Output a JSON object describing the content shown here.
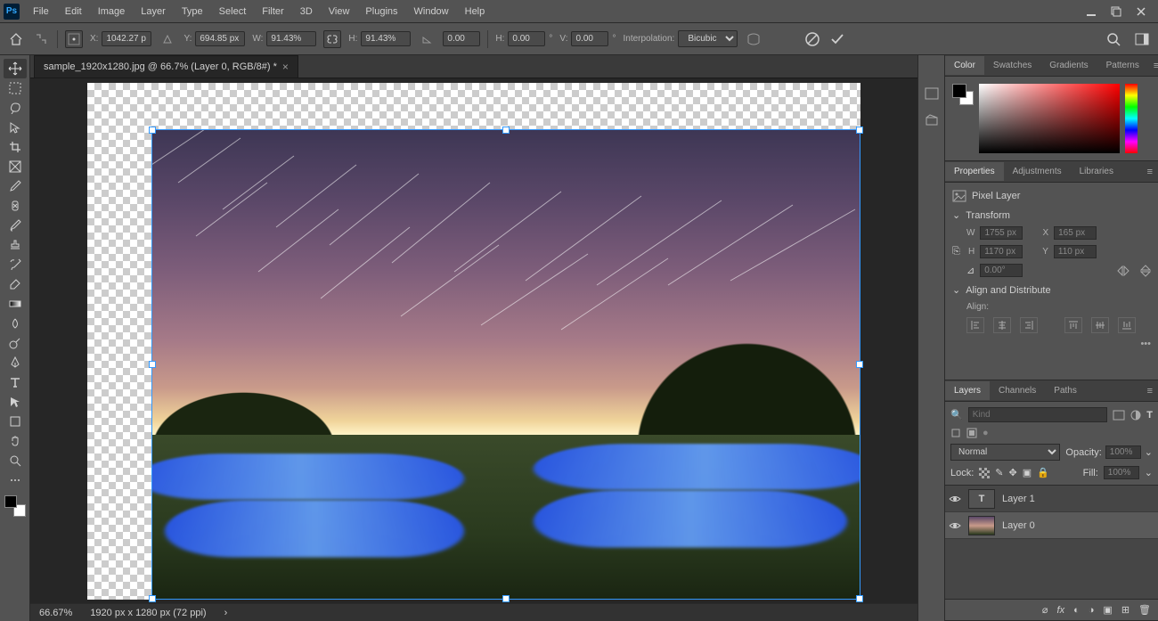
{
  "menu": {
    "items": [
      "File",
      "Edit",
      "Image",
      "Layer",
      "Type",
      "Select",
      "Filter",
      "3D",
      "View",
      "Plugins",
      "Window",
      "Help"
    ]
  },
  "options": {
    "x_label": "X:",
    "x": "1042.27 p",
    "y_label": "Y:",
    "y": "694.85 px",
    "w_label": "W:",
    "w": "91.43%",
    "h_label": "H:",
    "h": "91.43%",
    "angle": "0.00",
    "skew_h_label": "H:",
    "skew_h": "0.00",
    "skew_h_unit": "°",
    "skew_v_label": "V:",
    "skew_v": "0.00",
    "skew_v_unit": "°",
    "interp_label": "Interpolation:",
    "interp": "Bicubic"
  },
  "doc": {
    "tab": "sample_1920x1280.jpg @ 66.7% (Layer 0, RGB/8#) *"
  },
  "status": {
    "zoom": "66.67%",
    "dims": "1920 px x 1280 px (72 ppi)"
  },
  "panels": {
    "color": {
      "tabs": [
        "Color",
        "Swatches",
        "Gradients",
        "Patterns"
      ]
    },
    "props": {
      "tabs": [
        "Properties",
        "Adjustments",
        "Libraries"
      ],
      "type": "Pixel Layer",
      "transform": "Transform",
      "w_label": "W",
      "w": "1755 px",
      "x_label": "X",
      "x": "165 px",
      "h_label": "H",
      "h": "1170 px",
      "y_label": "Y",
      "y": "110 px",
      "angle": "0.00°",
      "align_header": "Align and Distribute",
      "align_label": "Align:"
    },
    "layers": {
      "tabs": [
        "Layers",
        "Channels",
        "Paths"
      ],
      "search_placeholder": "Kind",
      "blend": "Normal",
      "opacity_label": "Opacity:",
      "opacity": "100%",
      "lock_label": "Lock:",
      "fill_label": "Fill:",
      "fill": "100%",
      "items": [
        {
          "name": "Layer 1",
          "type": "text"
        },
        {
          "name": "Layer 0",
          "type": "img"
        }
      ]
    }
  }
}
